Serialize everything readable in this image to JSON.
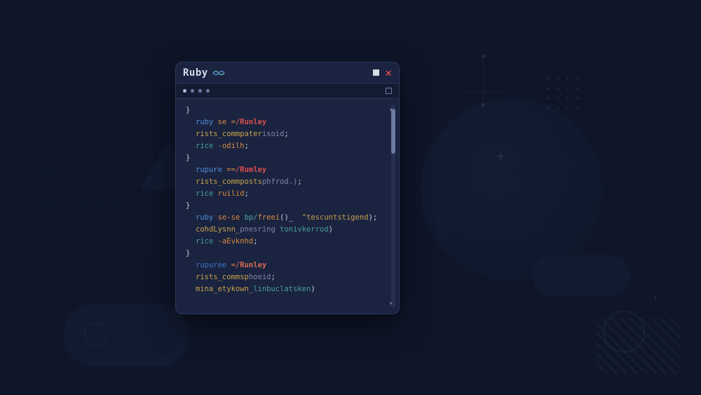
{
  "window": {
    "title": "Ruby",
    "icon": "ruby-lang-icon",
    "controls": {
      "minimize": "minimize",
      "close": "✕"
    }
  },
  "tabs": {
    "dot_count": 4
  },
  "code": {
    "lines": [
      {
        "cls": "",
        "parts": [
          {
            "c": "tok-brace",
            "t": "}"
          }
        ]
      },
      {
        "cls": "indent1",
        "parts": [
          {
            "c": "tok-kw1",
            "t": "ruby"
          },
          {
            "c": "",
            "t": " "
          },
          {
            "c": "tok-op",
            "t": "se"
          },
          {
            "c": "",
            "t": " "
          },
          {
            "c": "tok-op",
            "t": "="
          },
          {
            "c": "tok-path",
            "t": "/Runley"
          }
        ]
      },
      {
        "cls": "indent1",
        "parts": [
          {
            "c": "tok-ident",
            "t": "rists_commpater"
          },
          {
            "c": "tok-gray",
            "t": "isoid"
          },
          {
            "c": "tok-brace",
            "t": ";"
          }
        ]
      },
      {
        "cls": "indent1",
        "parts": [
          {
            "c": "tok-rice",
            "t": "rice"
          },
          {
            "c": "",
            "t": " "
          },
          {
            "c": "tok-flag",
            "t": "-odilh"
          },
          {
            "c": "tok-brace",
            "t": ";"
          }
        ]
      },
      {
        "cls": "",
        "parts": [
          {
            "c": "tok-brace",
            "t": "}"
          }
        ]
      },
      {
        "cls": "indent1",
        "parts": [
          {
            "c": "tok-kw1",
            "t": "rupure"
          },
          {
            "c": "",
            "t": " "
          },
          {
            "c": "tok-op",
            "t": "=="
          },
          {
            "c": "tok-path",
            "t": "/Rumley"
          }
        ]
      },
      {
        "cls": "indent1",
        "parts": [
          {
            "c": "tok-ident",
            "t": "rists_commposts"
          },
          {
            "c": "tok-gray",
            "t": "phfrod.)"
          },
          {
            "c": "tok-brace",
            "t": ";"
          }
        ]
      },
      {
        "cls": "indent1",
        "parts": [
          {
            "c": "tok-rice",
            "t": "rice"
          },
          {
            "c": "",
            "t": " "
          },
          {
            "c": "tok-flag",
            "t": "ruilid"
          },
          {
            "c": "tok-brace",
            "t": ";"
          }
        ]
      },
      {
        "cls": "",
        "parts": [
          {
            "c": "tok-brace",
            "t": "}"
          }
        ]
      },
      {
        "cls": "indent1",
        "parts": [
          {
            "c": "tok-kw1",
            "t": "ruby"
          },
          {
            "c": "",
            "t": " "
          },
          {
            "c": "tok-op",
            "t": "se-se"
          },
          {
            "c": "",
            "t": " "
          },
          {
            "c": "tok-bp",
            "t": "bp/"
          },
          {
            "c": "tok-fn",
            "t": "freei"
          },
          {
            "c": "tok-brace",
            "t": "()_  "
          },
          {
            "c": "tok-str",
            "t": "\"tescuntstigend"
          },
          {
            "c": "tok-brace",
            "t": ");"
          }
        ]
      },
      {
        "cls": "indent1",
        "parts": [
          {
            "c": "tok-call",
            "t": "cohdLysnn_"
          },
          {
            "c": "tok-gray",
            "t": "pnesring "
          },
          {
            "c": "tok-arg",
            "t": "tonivkerrod"
          },
          {
            "c": "tok-brace",
            "t": ")"
          }
        ]
      },
      {
        "cls": "indent1",
        "parts": [
          {
            "c": "tok-rice",
            "t": "rice"
          },
          {
            "c": "",
            "t": " "
          },
          {
            "c": "tok-flag",
            "t": "-aEvknhd"
          },
          {
            "c": "tok-brace",
            "t": ";"
          }
        ]
      },
      {
        "cls": "",
        "parts": [
          {
            "c": "tok-brace",
            "t": "}"
          }
        ]
      },
      {
        "cls": "indent1",
        "parts": [
          {
            "c": "tok-kw1b",
            "t": "rupuree"
          },
          {
            "c": "",
            "t": " "
          },
          {
            "c": "tok-op",
            "t": "="
          },
          {
            "c": "tok-path2",
            "t": "/Runley"
          }
        ]
      },
      {
        "cls": "indent1",
        "parts": [
          {
            "c": "tok-ident",
            "t": "rists_commsp"
          },
          {
            "c": "tok-gray",
            "t": "hoeid"
          },
          {
            "c": "tok-brace",
            "t": ";"
          }
        ]
      },
      {
        "cls": "indent1",
        "parts": [
          {
            "c": "tok-mina",
            "t": "mina_etykown_"
          },
          {
            "c": "tok-lin",
            "t": "linbuclatsken"
          },
          {
            "c": "tok-brace",
            "t": ")"
          }
        ]
      }
    ]
  }
}
